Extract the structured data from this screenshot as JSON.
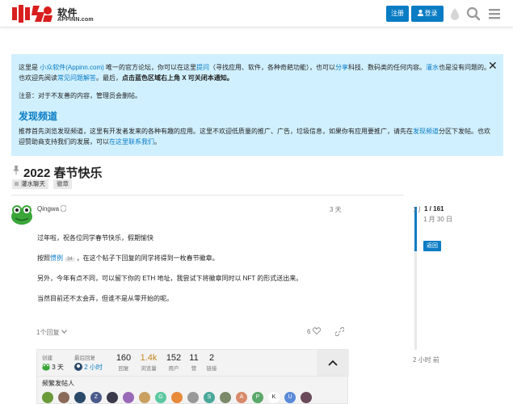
{
  "header": {
    "brand_cn": "软件",
    "brand_en": "APPINN.com",
    "signup_label": "注册",
    "login_label": "登录",
    "icons": [
      "drop-icon",
      "search-icon",
      "menu-icon"
    ]
  },
  "notice": {
    "p1_a": "这里是 ",
    "p1_link1": "小众软件(Appinn.com)",
    "p1_b": " 唯一的官方论坛，你可以在这里",
    "p1_link2": "提问",
    "p1_c": "（寻找应用、软件，各种奇葩功能），也可以",
    "p1_link3": "分享",
    "p1_d": "科技、数码类的任何内容。",
    "p1_link4": "灌水",
    "p1_e": "也是没有问题的。也欢迎先阅读",
    "p1_link5": "常见问题解答",
    "p1_f": "。最后，",
    "p1_bold": "点击蓝色区域右上角 X 可关闭本通知。",
    "p2": "注意：对于不友善的内容，管理员会删帖。",
    "heading": "发现频道",
    "p3_a": "推荐首先浏览发现频道，这里有开发者发来的各种有趣的应用。这里不欢迎低质量的推广、广告，垃圾信息，如果你有应用要推广，请先在",
    "p3_link1": "发现频道",
    "p3_b": "分区下发帖。也欢迎赞助商支持我们的发展，可以",
    "p3_link2": "在这里联系我们",
    "p3_c": "。",
    "close": "✕"
  },
  "topic": {
    "title": "2022 春节快乐",
    "category": "灌水聊天",
    "tag": "徽章"
  },
  "post": {
    "username": "Qingwa",
    "date": "3 天",
    "line1": "过年啦，祝各位同学春节快乐，假期愉快",
    "line2_a": "按照",
    "line2_link": "惯例",
    "line2_count": "34",
    "line2_b": "，在这个帖子下回复的同学将得到一枚春节徽章。",
    "line3": "另外，今年有点不同，可以留下你的 ETH 地址，我尝试下将徽章同时以 NFT 的形式送出来。",
    "line4": "当然目前还不太会弄，但谁不是从零开始的呢。",
    "replies_label": "1个回复",
    "likes_count": "6"
  },
  "summary": {
    "created_label": "创建",
    "created_value": "3 天",
    "last_reply_label": "最后回复",
    "last_reply_value": "2 小时",
    "stats": [
      {
        "value": "160",
        "label": "回复"
      },
      {
        "value": "1.4k",
        "label": "浏览量"
      },
      {
        "value": "152",
        "label": "用户"
      },
      {
        "value": "11",
        "label": "赞"
      },
      {
        "value": "2",
        "label": "链接"
      }
    ],
    "frequent_label": "频繁发帖人",
    "posters": [
      {
        "letter": "",
        "color": "#6a9a3a"
      },
      {
        "letter": "",
        "color": "#8a6a5a"
      },
      {
        "letter": "",
        "color": "#2a4a6a"
      },
      {
        "letter": "Z",
        "color": "#4a5a8a"
      },
      {
        "letter": "",
        "color": "#3a3a4a"
      },
      {
        "letter": "",
        "color": "#9a6ab8"
      },
      {
        "letter": "",
        "color": "#c8a060"
      },
      {
        "letter": "G",
        "color": "#5ac8a0"
      },
      {
        "letter": "",
        "color": "#e88a3a"
      },
      {
        "letter": "",
        "color": "#999999"
      },
      {
        "letter": "S",
        "color": "#4aa89a"
      },
      {
        "letter": "",
        "color": "#7a8a6a"
      },
      {
        "letter": "A",
        "color": "#d88a6a"
      },
      {
        "letter": "P",
        "color": "#5aa86a"
      },
      {
        "letter": "K",
        "color": "#ffffff"
      },
      {
        "letter": "U",
        "color": "#5a8ad8"
      },
      {
        "letter": "",
        "color": "#6a4a5a"
      }
    ]
  },
  "timeline": {
    "start": "1 月",
    "count": "1 / 161",
    "date": "1 月 30 日",
    "back": "返回",
    "end": "2 小时 前"
  }
}
